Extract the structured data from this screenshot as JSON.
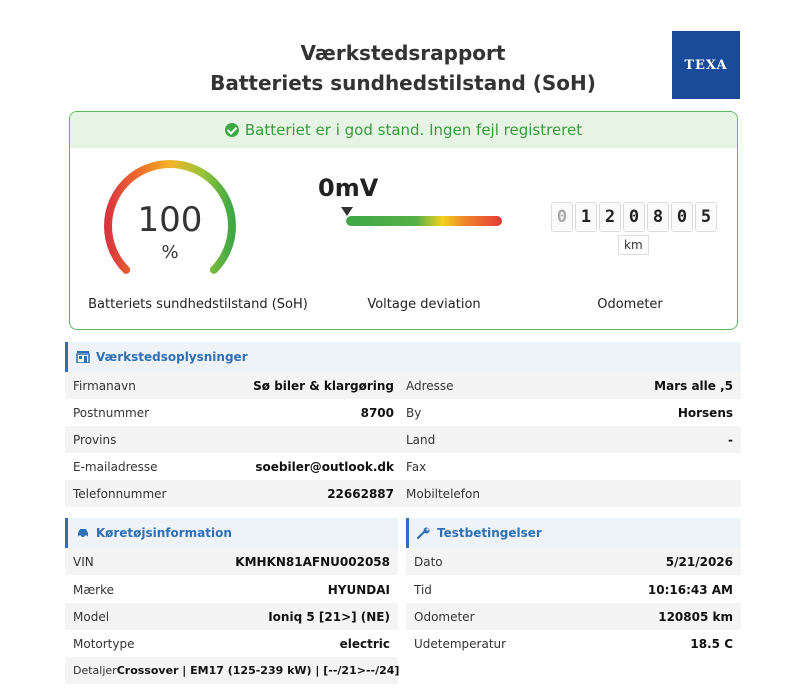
{
  "header": {
    "title_line1": "Værkstedsrapport",
    "title_line2": "Batteriets sundhedstilstand (SoH)",
    "logo_text": "TEXA"
  },
  "status": {
    "message": "Batteriet er i god stand. Ingen fejl registreret",
    "icon": "check-circle-icon"
  },
  "soh": {
    "value": "100",
    "unit": "%",
    "caption": "Batteriets sundhedstilstand (SoH)",
    "fraction": 1.0
  },
  "voltage": {
    "value": "0mV",
    "caption": "Voltage deviation",
    "marker_fraction": 0
  },
  "odometer": {
    "digits": [
      "0",
      "1",
      "2",
      "0",
      "8",
      "0",
      "5"
    ],
    "unit": "km",
    "caption": "Odometer"
  },
  "workshop": {
    "title": "Værkstedsoplysninger",
    "icon": "building-icon",
    "rows": [
      {
        "k1": "Firmanavn",
        "v1": "Sø biler & klargøring",
        "k2": "Adresse",
        "v2": "Mars alle ,5"
      },
      {
        "k1": "Postnummer",
        "v1": "8700",
        "k2": "By",
        "v2": "Horsens"
      },
      {
        "k1": "Provins",
        "v1": "",
        "k2": "Land",
        "v2": "-"
      },
      {
        "k1": "E-mailadresse",
        "v1": "soebiler@outlook.dk",
        "k2": "Fax",
        "v2": ""
      },
      {
        "k1": "Telefonnummer",
        "v1": "22662887",
        "k2": "Mobiltelefon",
        "v2": ""
      }
    ]
  },
  "vehicle": {
    "title": "Køretøjsinformation",
    "icon": "car-icon",
    "rows": [
      {
        "k": "VIN",
        "v": "KMHKN81AFNU002058"
      },
      {
        "k": "Mærke",
        "v": "HYUNDAI"
      },
      {
        "k": "Model",
        "v": "Ioniq 5 [21>] (NE)"
      },
      {
        "k": "Motortype",
        "v": "electric"
      },
      {
        "k": "Detaljer",
        "v": "Crossover | EM17 (125-239 kW) | [--/21>--/24]"
      }
    ]
  },
  "test": {
    "title": "Testbetingelser",
    "icon": "wrench-icon",
    "rows": [
      {
        "k": "Dato",
        "v": "5/21/2026"
      },
      {
        "k": "Tid",
        "v": "10:16:43 AM"
      },
      {
        "k": "Odometer",
        "v": "120805 km"
      },
      {
        "k": "Udetemperatur",
        "v": "18.5 C"
      }
    ]
  },
  "colors": {
    "accent": "#2f6fb5",
    "ok_green": "#3fa846",
    "logo_blue": "#1a4b9b"
  }
}
